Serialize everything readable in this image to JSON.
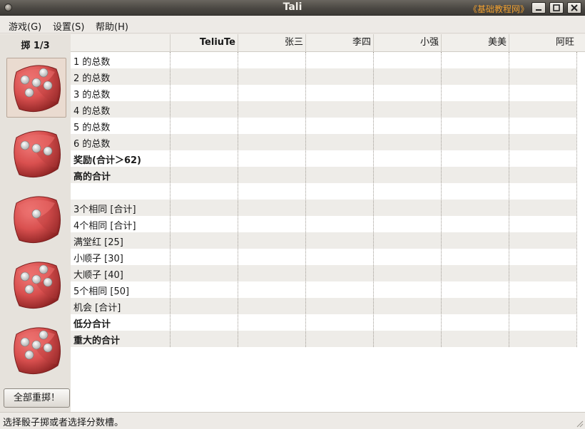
{
  "window": {
    "title": "Tali",
    "watermark": "《基础教程网》"
  },
  "menu": [
    {
      "label": "游戏(G)"
    },
    {
      "label": "设置(S)"
    },
    {
      "label": "帮助(H)"
    }
  ],
  "dice_panel": {
    "roll_count": "掷 1/3",
    "dice": [
      {
        "value": 5,
        "held": true
      },
      {
        "value": 3,
        "held": false
      },
      {
        "value": 1,
        "held": false
      },
      {
        "value": 5,
        "held": false
      },
      {
        "value": 5,
        "held": false
      }
    ],
    "reroll_label": "全部重掷！"
  },
  "scoreboard": {
    "players": [
      "TeliuTe",
      "张三",
      "李四",
      "小强",
      "美美",
      "阿旺"
    ],
    "rows": [
      {
        "label": "1 的总数",
        "bold": false
      },
      {
        "label": "2 的总数",
        "bold": false
      },
      {
        "label": "3 的总数",
        "bold": false
      },
      {
        "label": "4 的总数",
        "bold": false
      },
      {
        "label": "5 的总数",
        "bold": false
      },
      {
        "label": "6 的总数",
        "bold": false
      },
      {
        "label": "奖励(合计＞62)",
        "bold": true
      },
      {
        "label": "高的合计",
        "bold": true
      },
      {
        "label": "",
        "bold": false
      },
      {
        "label": "3个相同 [合计]",
        "bold": false
      },
      {
        "label": "4个相同 [合计]",
        "bold": false
      },
      {
        "label": "满堂红 [25]",
        "bold": false
      },
      {
        "label": "小顺子 [30]",
        "bold": false
      },
      {
        "label": "大顺子 [40]",
        "bold": false
      },
      {
        "label": "5个相同 [50]",
        "bold": false
      },
      {
        "label": "机会 [合计]",
        "bold": false
      },
      {
        "label": "低分合计",
        "bold": true
      },
      {
        "label": "重大的合计",
        "bold": true
      }
    ]
  },
  "status": {
    "text": "选择骰子掷或者选择分数槽。"
  },
  "colors": {
    "die_red": "#d9504f",
    "pip": "#e6e6e6",
    "watermark": "#f0a030"
  }
}
